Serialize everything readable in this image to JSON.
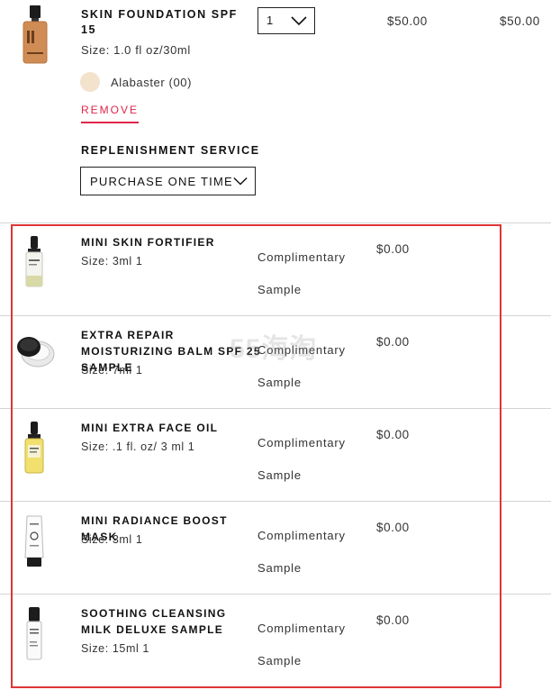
{
  "product": {
    "title": "SKIN FOUNDATION SPF 15",
    "size": "Size: 1.0 fl oz/30ml",
    "shade": "Alabaster (00)",
    "remove_label": "REMOVE",
    "quantity": "1",
    "unit_price": "$50.00",
    "total_price": "$50.00",
    "swatch_color": "#f3e2cc"
  },
  "replenishment": {
    "title": "REPLENISHMENT SERVICE",
    "selected": "PURCHASE ONE TIME"
  },
  "samples": [
    {
      "name": "MINI SKIN FORTIFIER",
      "size": "Size: 3ml 1",
      "label": "Complimentary Sample",
      "price": "$0.00",
      "icon": "dropper-bottle-icon"
    },
    {
      "name": "EXTRA REPAIR MOISTURIZING BALM SPF 25 SAMPLE",
      "size": "Size: 7ml 1",
      "label": "Complimentary Sample",
      "price": "$0.00",
      "icon": "jar-icon"
    },
    {
      "name": "MINI EXTRA FACE OIL",
      "size": "Size: .1 fl. oz/ 3 ml 1",
      "label": "Complimentary Sample",
      "price": "$0.00",
      "icon": "oil-bottle-icon"
    },
    {
      "name": "MINI RADIANCE BOOST MASK",
      "size": "Size: 3ml 1",
      "label": "Complimentary Sample",
      "price": "$0.00",
      "icon": "tube-icon"
    },
    {
      "name": "SOOTHING CLEANSING MILK DELUXE SAMPLE",
      "size": "Size: 15ml 1",
      "label": "Complimentary Sample",
      "price": "$0.00",
      "icon": "pump-bottle-icon"
    }
  ],
  "watermark": "55海淘",
  "colors": {
    "accent": "#e0254a",
    "highlight": "#e03535",
    "divider": "#d4d4d4"
  }
}
